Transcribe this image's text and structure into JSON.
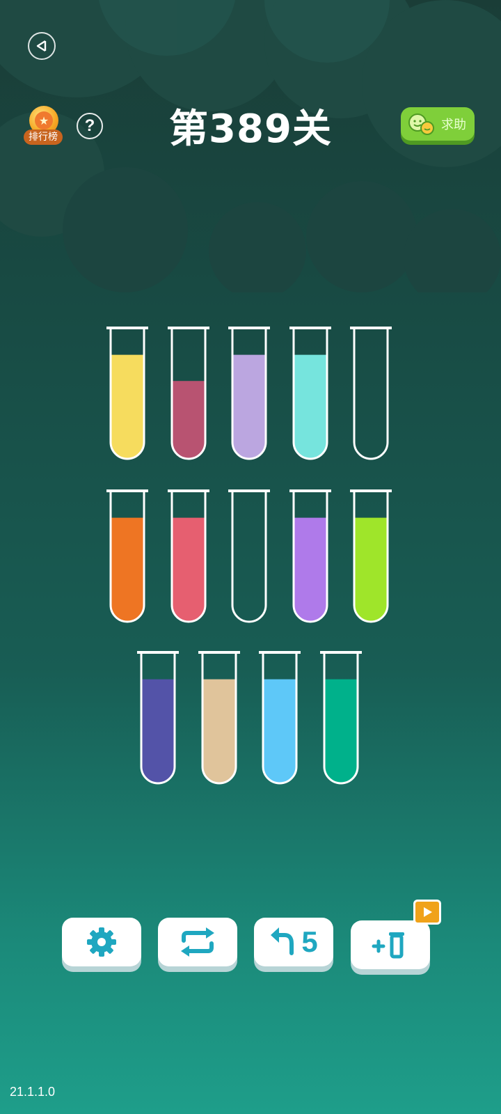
{
  "header": {
    "level_title": "第389关",
    "leaderboard_label": "排行榜",
    "help_icon_text": "?",
    "help_request_label": "求助"
  },
  "tubes": [
    {
      "row": 1,
      "color": "#f6dc5e",
      "fill_level": 0.8
    },
    {
      "row": 1,
      "color": "#b85371",
      "fill_level": 0.6
    },
    {
      "row": 1,
      "color": "#bba6e0",
      "fill_level": 0.8
    },
    {
      "row": 1,
      "color": "#76e4dd",
      "fill_level": 0.8
    },
    {
      "row": 1,
      "color": null,
      "fill_level": 0
    },
    {
      "row": 2,
      "color": "#ee7523",
      "fill_level": 0.8
    },
    {
      "row": 2,
      "color": "#e65f70",
      "fill_level": 0.8
    },
    {
      "row": 2,
      "color": null,
      "fill_level": 0
    },
    {
      "row": 2,
      "color": "#af7aea",
      "fill_level": 0.8
    },
    {
      "row": 2,
      "color": "#9fe52a",
      "fill_level": 0.8
    },
    {
      "row": 3,
      "color": "#5353a8",
      "fill_level": 0.8
    },
    {
      "row": 3,
      "color": "#e0c49b",
      "fill_level": 0.8
    },
    {
      "row": 3,
      "color": "#5ec8f8",
      "fill_level": 0.8
    },
    {
      "row": 3,
      "color": "#00b18b",
      "fill_level": 0.8
    }
  ],
  "toolbar": {
    "undo_count": "5",
    "accent_color": "#1fa7c0"
  },
  "icons": {
    "back": "back-triangle-icon",
    "leaderboard": "medal-star-icon",
    "help": "question-icon",
    "help_request": "smile-faces-icon",
    "settings": "gear-icon",
    "restart": "repeat-arrows-icon",
    "undo": "undo-arrow-icon",
    "add_tube": "add-tube-icon",
    "video": "video-play-icon"
  },
  "version": "21.1.1.0"
}
